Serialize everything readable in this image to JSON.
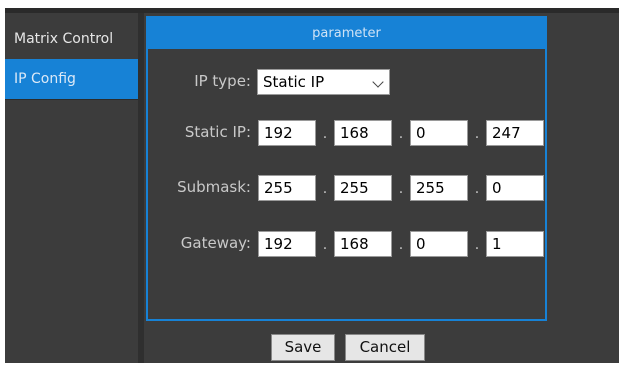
{
  "sidebar": {
    "items": [
      {
        "label": "Matrix Control"
      },
      {
        "label": "IP Config"
      }
    ]
  },
  "panel": {
    "title": "parameter"
  },
  "ip_type": {
    "label": "IP type:",
    "value": "Static IP"
  },
  "static_ip": {
    "label": "Static IP:",
    "octets": [
      "192",
      "168",
      "0",
      "247"
    ]
  },
  "submask": {
    "label": "Submask:",
    "octets": [
      "255",
      "255",
      "255",
      "0"
    ]
  },
  "gateway": {
    "label": "Gateway:",
    "octets": [
      "192",
      "168",
      "0",
      "1"
    ]
  },
  "separator": ".",
  "buttons": {
    "save": "Save",
    "cancel": "Cancel"
  },
  "colors": {
    "accent": "#1782d6",
    "background": "#3c3c3c"
  }
}
